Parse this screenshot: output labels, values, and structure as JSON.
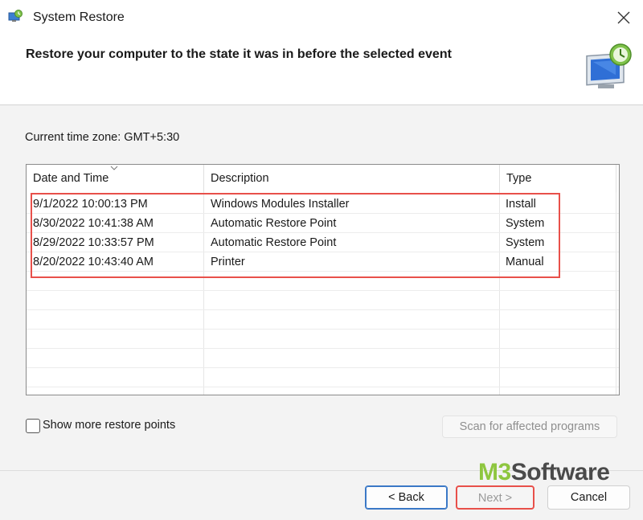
{
  "window": {
    "title": "System Restore",
    "close_icon": "close-icon"
  },
  "header": {
    "text": "Restore your computer to the state it was in before the selected event"
  },
  "timezone": "Current time zone: GMT+5:30",
  "table": {
    "columns": [
      "Date and Time",
      "Description",
      "Type"
    ],
    "rows": [
      {
        "date": "9/1/2022 10:00:13 PM",
        "description": "Windows Modules Installer",
        "type": "Install"
      },
      {
        "date": "8/30/2022 10:41:38 AM",
        "description": "Automatic Restore Point",
        "type": "System"
      },
      {
        "date": "8/29/2022 10:33:57 PM",
        "description": "Automatic Restore Point",
        "type": "System"
      },
      {
        "date": "8/20/2022 10:43:40 AM",
        "description": "Printer",
        "type": "Manual"
      }
    ],
    "highlight_color": "#e8504a"
  },
  "show_more": {
    "label": "Show more restore points",
    "checked": false
  },
  "scan_button": "Scan for affected programs",
  "buttons": {
    "back": "< Back",
    "next": "Next >",
    "cancel": "Cancel"
  },
  "watermark": {
    "m3": "M3",
    "software": "Software"
  },
  "colors": {
    "accent": "#3a78c6",
    "highlight": "#e8504a",
    "brand_green": "#8ec63f"
  }
}
